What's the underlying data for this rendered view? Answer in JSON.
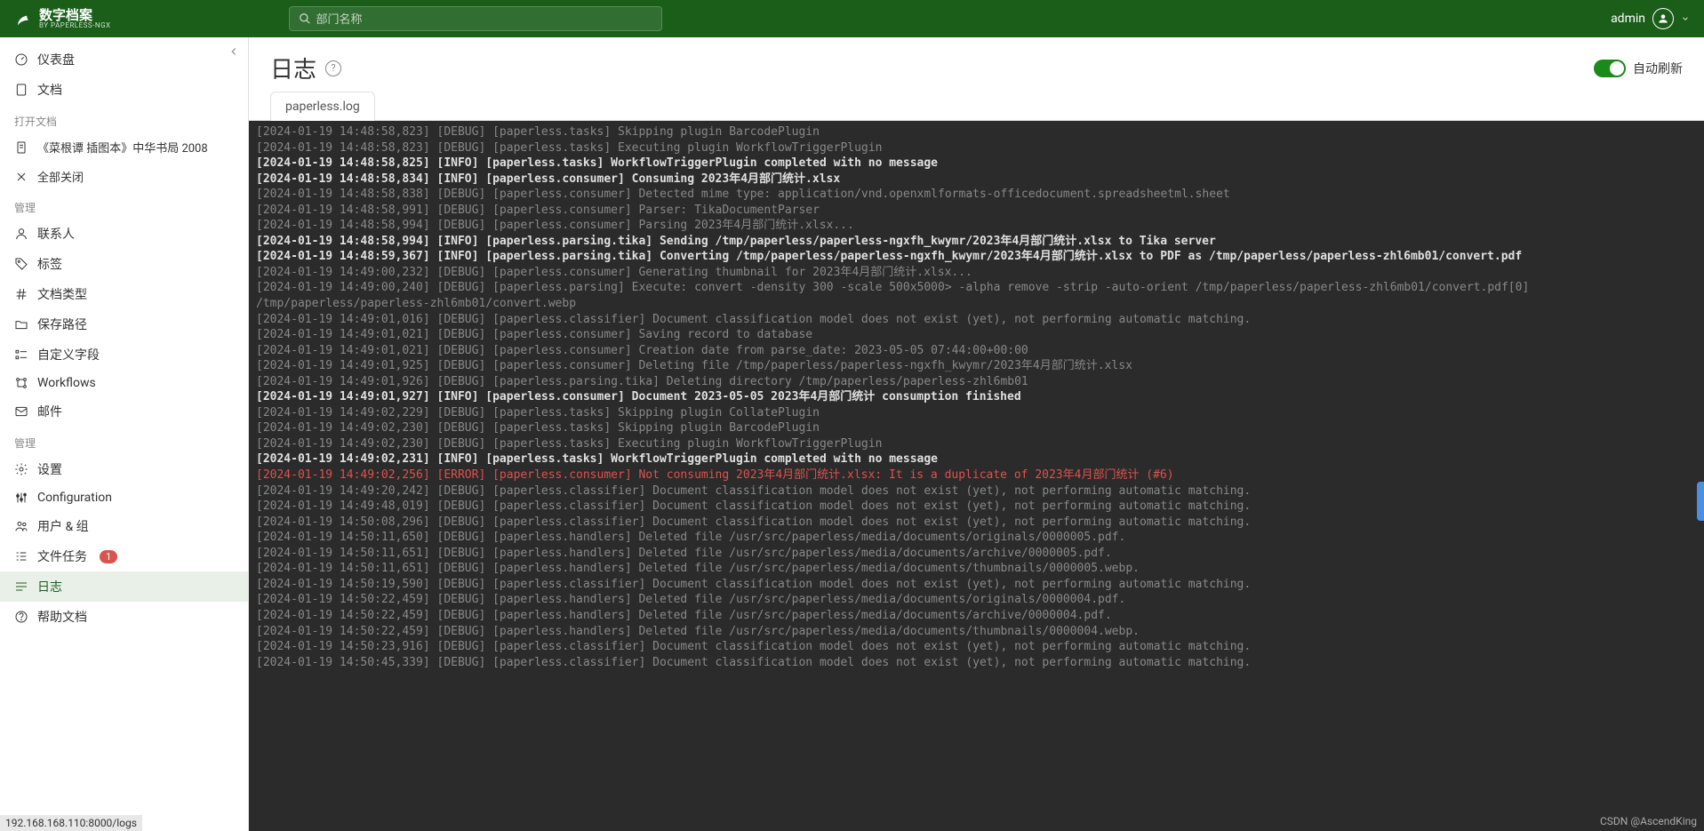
{
  "header": {
    "app_title": "数字档案",
    "app_subtitle": "BY PAPERLESS-NGX",
    "search_placeholder": "部门名称",
    "username": "admin"
  },
  "sidebar": {
    "top": [
      {
        "icon": "dashboard",
        "label": "仪表盘"
      },
      {
        "icon": "document",
        "label": "文档"
      }
    ],
    "open_docs_label": "打开文档",
    "open_docs": [
      {
        "icon": "doc",
        "label": "《菜根谭 插图本》中华书局 2008"
      },
      {
        "icon": "close",
        "label": "全部关闭"
      }
    ],
    "manage_label": "管理",
    "manage": [
      {
        "icon": "user",
        "label": "联系人"
      },
      {
        "icon": "tag",
        "label": "标签"
      },
      {
        "icon": "hash",
        "label": "文档类型"
      },
      {
        "icon": "folder",
        "label": "保存路径"
      },
      {
        "icon": "fields",
        "label": "自定义字段"
      },
      {
        "icon": "workflow",
        "label": "Workflows"
      },
      {
        "icon": "mail",
        "label": "邮件"
      }
    ],
    "admin_label": "管理",
    "admin": [
      {
        "icon": "gear",
        "label": "设置"
      },
      {
        "icon": "sliders",
        "label": "Configuration"
      },
      {
        "icon": "users",
        "label": "用户 & 组"
      },
      {
        "icon": "task",
        "label": "文件任务",
        "badge": "1"
      },
      {
        "icon": "log",
        "label": "日志",
        "active": true
      },
      {
        "icon": "help",
        "label": "帮助文档"
      }
    ]
  },
  "page": {
    "title": "日志",
    "auto_refresh_label": "自动刷新",
    "tab_label": "paperless.log"
  },
  "logs": [
    {
      "level": "debug",
      "text": "[2024-01-19 14:48:58,823] [DEBUG] [paperless.tasks] Skipping plugin BarcodePlugin"
    },
    {
      "level": "debug",
      "text": "[2024-01-19 14:48:58,823] [DEBUG] [paperless.tasks] Executing plugin WorkflowTriggerPlugin"
    },
    {
      "level": "info",
      "text": "[2024-01-19 14:48:58,825] [INFO] [paperless.tasks] WorkflowTriggerPlugin completed with no message"
    },
    {
      "level": "info",
      "text": "[2024-01-19 14:48:58,834] [INFO] [paperless.consumer] Consuming 2023年4月部门统计.xlsx"
    },
    {
      "level": "debug",
      "text": "[2024-01-19 14:48:58,838] [DEBUG] [paperless.consumer] Detected mime type: application/vnd.openxmlformats-officedocument.spreadsheetml.sheet"
    },
    {
      "level": "debug",
      "text": "[2024-01-19 14:48:58,991] [DEBUG] [paperless.consumer] Parser: TikaDocumentParser"
    },
    {
      "level": "debug",
      "text": "[2024-01-19 14:48:58,994] [DEBUG] [paperless.consumer] Parsing 2023年4月部门统计.xlsx..."
    },
    {
      "level": "info",
      "text": "[2024-01-19 14:48:58,994] [INFO] [paperless.parsing.tika] Sending /tmp/paperless/paperless-ngxfh_kwymr/2023年4月部门统计.xlsx to Tika server"
    },
    {
      "level": "info",
      "text": "[2024-01-19 14:48:59,367] [INFO] [paperless.parsing.tika] Converting /tmp/paperless/paperless-ngxfh_kwymr/2023年4月部门统计.xlsx to PDF as /tmp/paperless/paperless-zhl6mb01/convert.pdf"
    },
    {
      "level": "debug",
      "text": "[2024-01-19 14:49:00,232] [DEBUG] [paperless.consumer] Generating thumbnail for 2023年4月部门统计.xlsx..."
    },
    {
      "level": "debug",
      "text": "[2024-01-19 14:49:00,240] [DEBUG] [paperless.parsing] Execute: convert -density 300 -scale 500x5000> -alpha remove -strip -auto-orient /tmp/paperless/paperless-zhl6mb01/convert.pdf[0] /tmp/paperless/paperless-zhl6mb01/convert.webp"
    },
    {
      "level": "debug",
      "text": "[2024-01-19 14:49:01,016] [DEBUG] [paperless.classifier] Document classification model does not exist (yet), not performing automatic matching."
    },
    {
      "level": "debug",
      "text": "[2024-01-19 14:49:01,021] [DEBUG] [paperless.consumer] Saving record to database"
    },
    {
      "level": "debug",
      "text": "[2024-01-19 14:49:01,021] [DEBUG] [paperless.consumer] Creation date from parse_date: 2023-05-05 07:44:00+00:00"
    },
    {
      "level": "debug",
      "text": "[2024-01-19 14:49:01,925] [DEBUG] [paperless.consumer] Deleting file /tmp/paperless/paperless-ngxfh_kwymr/2023年4月部门统计.xlsx"
    },
    {
      "level": "debug",
      "text": "[2024-01-19 14:49:01,926] [DEBUG] [paperless.parsing.tika] Deleting directory /tmp/paperless/paperless-zhl6mb01"
    },
    {
      "level": "info",
      "text": "[2024-01-19 14:49:01,927] [INFO] [paperless.consumer] Document 2023-05-05 2023年4月部门统计 consumption finished"
    },
    {
      "level": "debug",
      "text": "[2024-01-19 14:49:02,229] [DEBUG] [paperless.tasks] Skipping plugin CollatePlugin"
    },
    {
      "level": "debug",
      "text": "[2024-01-19 14:49:02,230] [DEBUG] [paperless.tasks] Skipping plugin BarcodePlugin"
    },
    {
      "level": "debug",
      "text": "[2024-01-19 14:49:02,230] [DEBUG] [paperless.tasks] Executing plugin WorkflowTriggerPlugin"
    },
    {
      "level": "info",
      "text": "[2024-01-19 14:49:02,231] [INFO] [paperless.tasks] WorkflowTriggerPlugin completed with no message"
    },
    {
      "level": "error",
      "text": "[2024-01-19 14:49:02,256] [ERROR] [paperless.consumer] Not consuming 2023年4月部门统计.xlsx: It is a duplicate of 2023年4月部门统计 (#6)"
    },
    {
      "level": "debug",
      "text": "[2024-01-19 14:49:20,242] [DEBUG] [paperless.classifier] Document classification model does not exist (yet), not performing automatic matching."
    },
    {
      "level": "debug",
      "text": "[2024-01-19 14:49:48,019] [DEBUG] [paperless.classifier] Document classification model does not exist (yet), not performing automatic matching."
    },
    {
      "level": "debug",
      "text": "[2024-01-19 14:50:08,296] [DEBUG] [paperless.classifier] Document classification model does not exist (yet), not performing automatic matching."
    },
    {
      "level": "debug",
      "text": "[2024-01-19 14:50:11,650] [DEBUG] [paperless.handlers] Deleted file /usr/src/paperless/media/documents/originals/0000005.pdf."
    },
    {
      "level": "debug",
      "text": "[2024-01-19 14:50:11,651] [DEBUG] [paperless.handlers] Deleted file /usr/src/paperless/media/documents/archive/0000005.pdf."
    },
    {
      "level": "debug",
      "text": "[2024-01-19 14:50:11,651] [DEBUG] [paperless.handlers] Deleted file /usr/src/paperless/media/documents/thumbnails/0000005.webp."
    },
    {
      "level": "debug",
      "text": "[2024-01-19 14:50:19,590] [DEBUG] [paperless.classifier] Document classification model does not exist (yet), not performing automatic matching."
    },
    {
      "level": "debug",
      "text": "[2024-01-19 14:50:22,459] [DEBUG] [paperless.handlers] Deleted file /usr/src/paperless/media/documents/originals/0000004.pdf."
    },
    {
      "level": "debug",
      "text": "[2024-01-19 14:50:22,459] [DEBUG] [paperless.handlers] Deleted file /usr/src/paperless/media/documents/archive/0000004.pdf."
    },
    {
      "level": "debug",
      "text": "[2024-01-19 14:50:22,459] [DEBUG] [paperless.handlers] Deleted file /usr/src/paperless/media/documents/thumbnails/0000004.webp."
    },
    {
      "level": "debug",
      "text": "[2024-01-19 14:50:23,916] [DEBUG] [paperless.classifier] Document classification model does not exist (yet), not performing automatic matching."
    },
    {
      "level": "debug",
      "text": "[2024-01-19 14:50:45,339] [DEBUG] [paperless.classifier] Document classification model does not exist (yet), not performing automatic matching."
    }
  ],
  "status_bar": "192.168.168.110:8000/logs",
  "watermark": "CSDN @AscendKing"
}
